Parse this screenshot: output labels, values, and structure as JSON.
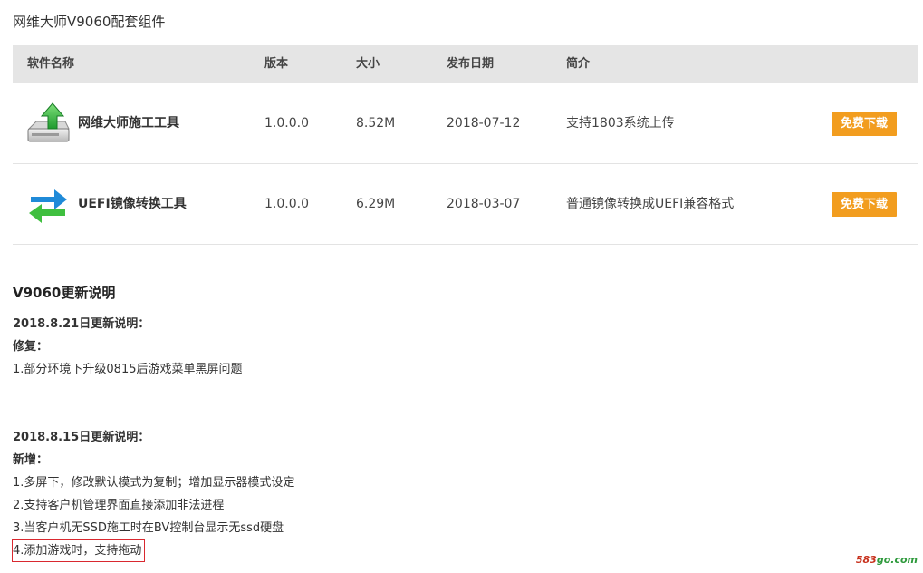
{
  "page": {
    "title": "网维大师V9060配套组件"
  },
  "table": {
    "headers": {
      "name": "软件名称",
      "version": "版本",
      "size": "大小",
      "date": "发布日期",
      "description": "简介"
    },
    "rows": [
      {
        "icon": "install-upload-icon",
        "name": "网维大师施工工具",
        "version": "1.0.0.0",
        "size": "8.52M",
        "date": "2018-07-12",
        "description": "支持1803系统上传",
        "button_label": "免费下载"
      },
      {
        "icon": "convert-arrows-icon",
        "name": "UEFI镜像转换工具",
        "version": "1.0.0.0",
        "size": "6.29M",
        "date": "2018-03-07",
        "description": "普通镜像转换成UEFI兼容格式",
        "button_label": "免费下载"
      }
    ]
  },
  "notes": {
    "title": "V9060更新说明",
    "sections": [
      {
        "heading": "2018.8.21日更新说明：",
        "subheading": "修复：",
        "items": [
          "1.部分环境下升级0815后游戏菜单黑屏问题"
        ]
      },
      {
        "heading": "2018.8.15日更新说明：",
        "subheading": "新增：",
        "items": [
          "1.多屏下，修改默认模式为复制；增加显示器模式设定",
          "2.支持客户机管理界面直接添加非法进程",
          "3.当客户机无SSD施工时在BV控制台显示无ssd硬盘",
          "4.添加游戏时，支持拖动"
        ]
      }
    ]
  },
  "watermark": {
    "num": "583",
    "rest": "go.com"
  },
  "colors": {
    "header_bg": "#e5e5e5",
    "button_bg": "#f29d1f",
    "highlight_border": "#d9282f",
    "watermark_green": "#2e9a3c",
    "watermark_red": "#c8321e"
  }
}
